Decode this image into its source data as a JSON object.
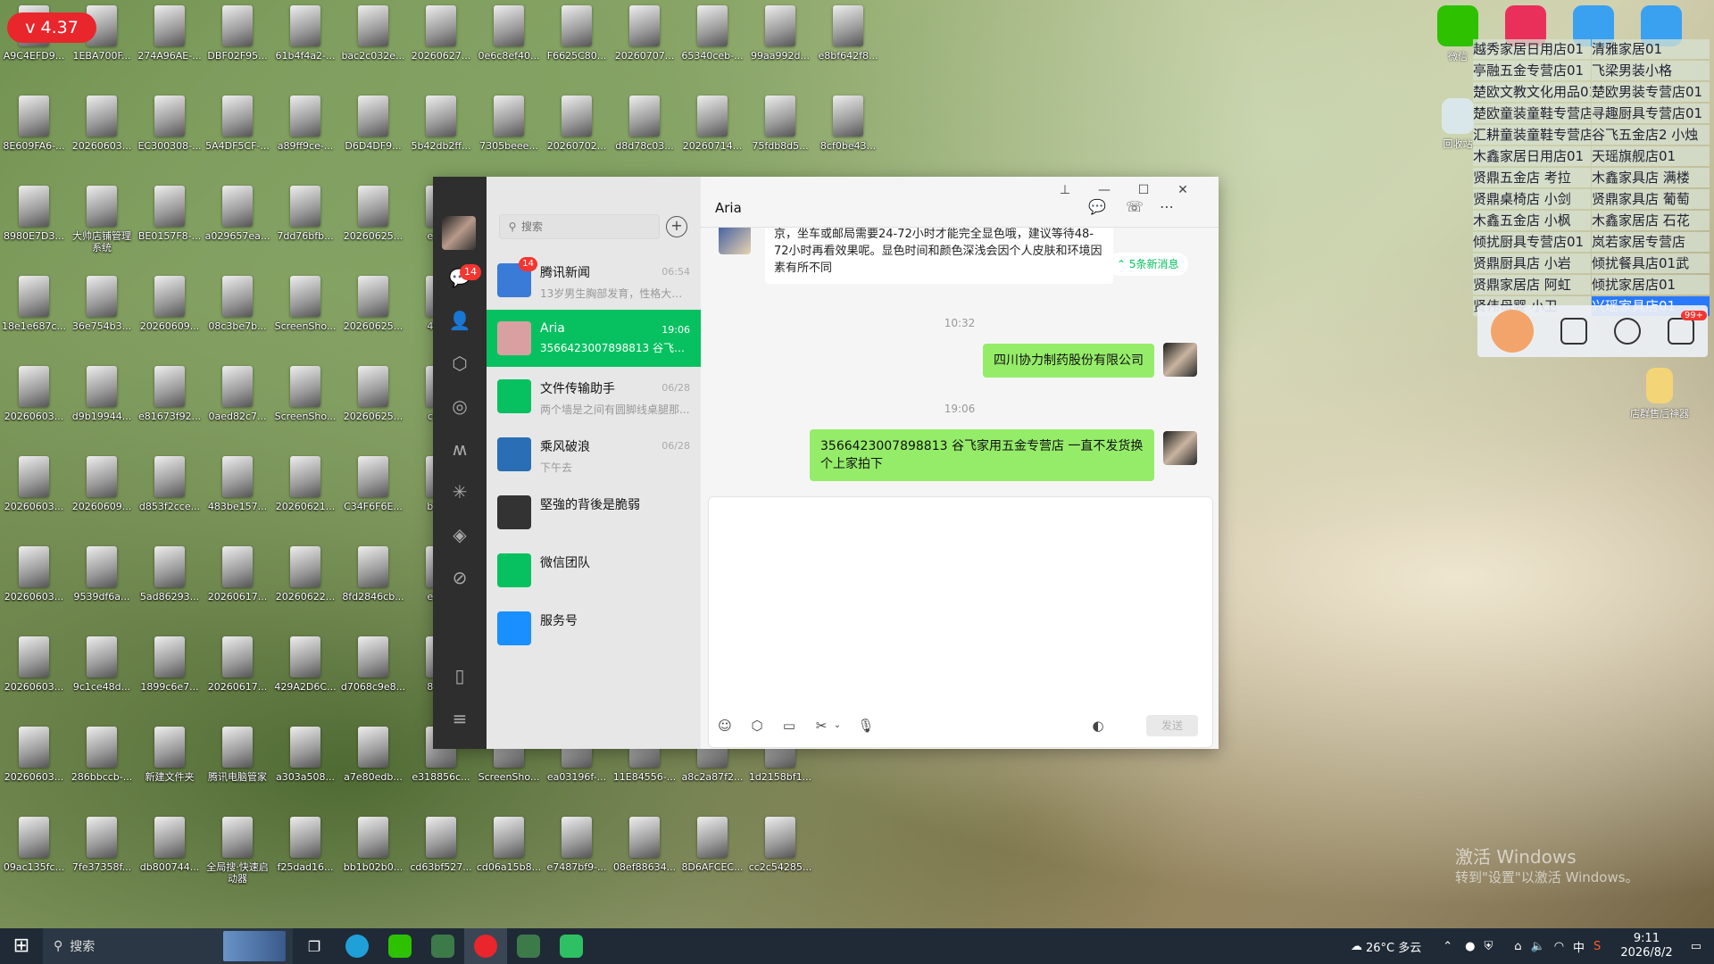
{
  "version_badge": "v 4.37",
  "desktop_labels": [
    "A9C4EFD9...",
    "1EBA700F...",
    "274A96AE-...",
    "DBF02F95...",
    "61b4f4a2-...",
    "bac2c032e...",
    "20260627...",
    "0e6c8ef40...",
    "F6625C80...",
    "20260707...",
    "65340ceb-...",
    "99aa992d...",
    "e8bf642f8...",
    "8E609FA6-...",
    "20260603...",
    "EC300308-...",
    "5A4DF5CF-...",
    "a89ff9ce-...",
    "D6D4DF9...",
    "5b42db2ff...",
    "7305beee...",
    "20260702...",
    "d8d78c03...",
    "20260714...",
    "75fdb8d5...",
    "8cf0be43...",
    "8980E7D3...",
    "大帅店铺管理系统",
    "BE0157F8-...",
    "a029657ea...",
    "7dd76bfb...",
    "20260625...",
    "e30...",
    "18e1e687c...",
    "36e754b3...",
    "20260609...",
    "08c3be7b...",
    "ScreenSho...",
    "20260625...",
    "4e8...",
    "20260603...",
    "d9b19944...",
    "e81673f92...",
    "0aed82c7...",
    "ScreenSho...",
    "20260625...",
    "ce3...",
    "20260603...",
    "20260609...",
    "d853f2cce...",
    "483be157...",
    "20260621...",
    "C34F6F6E...",
    "bd7...",
    "20260603...",
    "9539df6a...",
    "5ad86293...",
    "20260617...",
    "20260622...",
    "8fd2846cb...",
    "e79...",
    "20260603...",
    "9c1ce48d...",
    "1899c6e7...",
    "20260617...",
    "429A2D6C...",
    "d7068c9e8...",
    "857...",
    "20260603...",
    "286bbccb-...",
    "新建文件夹",
    "腾讯电脑管家",
    "a303a508...",
    "a7e80edb...",
    "e318856c...",
    "ScreenSho...",
    "ea03196f-...",
    "11E84556-...",
    "a8c2a87f2...",
    "1d2158bf1...",
    "09ac135fc...",
    "7fe37358f...",
    "db800744...",
    "全局搜·快速启动器",
    "f25dad16...",
    "bb1b02b0...",
    "cd63bf527...",
    "cd06a15b8...",
    "e7487bf9-...",
    "08ef88634...",
    "8D6AFCEC...",
    "cc2c54285..."
  ],
  "right_icons": {
    "wechat": "微信",
    "recycle": "回收站",
    "tool": "店群售后神器"
  },
  "right_panel_rows": [
    [
      "越秀家居日用店01",
      "清雅家居01"
    ],
    [
      "亭融五金专营店01",
      "飞梁男装小格"
    ],
    [
      "楚欧文教文化用品01",
      "楚欧男装专营店01"
    ],
    [
      "楚欧童装童鞋专营店",
      "寻趣厨具专营店01"
    ],
    [
      "汇耕童装童鞋专营店",
      "谷飞五金店2 小烛"
    ],
    [
      "木鑫家居日用店01",
      "天瑶旗舰店01"
    ],
    [
      "贤鼎五金店 考拉",
      "木鑫家具店 满楼"
    ],
    [
      "贤鼎桌椅店 小剑",
      "贤鼎家具店 葡萄"
    ],
    [
      "木鑫五金店 小枫",
      "木鑫家居店 石花"
    ],
    [
      "倾扰厨具专营店01",
      "岚若家居专营店"
    ],
    [
      "贤鼎厨具店 小岩",
      "倾扰餐具店01武"
    ],
    [
      "贤鼎家居店 阿虹",
      "倾扰家居店01"
    ],
    [
      "贤伟母婴 小卫",
      "兴瑶家具店01"
    ]
  ],
  "right_tool_badge": "99+",
  "wechat": {
    "nav_badge": "14",
    "search_placeholder": "搜索",
    "add_symbol": "+",
    "chats": [
      {
        "name": "腾讯新闻",
        "preview": "13岁男生胸部发育，性格大变...",
        "time": "06:54",
        "badge": "14"
      },
      {
        "name": "Aria",
        "preview": "3566423007898813 谷飞家...",
        "time": "19:06"
      },
      {
        "name": "文件传输助手",
        "preview": "两个墙是之间有圆脚线桌腿那...",
        "time": "06/28"
      },
      {
        "name": "乘风破浪",
        "preview": "下午去",
        "time": "06/28"
      },
      {
        "name": "堅強的背後是脆弱",
        "preview": "",
        "time": ""
      },
      {
        "name": "微信团队",
        "preview": "",
        "time": ""
      },
      {
        "name": "服务号",
        "preview": "",
        "time": ""
      }
    ],
    "title": "Aria",
    "window_controls": {
      "pin": "⊥",
      "min": "—",
      "max": "☐",
      "close": "✕"
    },
    "incoming_msg": "京，坐车或邮局需要24-72小时才能完全显色哦，建议等待48-72小时再看效果呢。显色时间和颜色深浅会因个人皮肤和环境因素有所不同",
    "new_msg_pill": "⌃ 5条新消息",
    "time1": "10:32",
    "out1": "四川协力制药股份有限公司",
    "time2": "19:06",
    "out2": "3566423007898813 谷飞家用五金专营店 一直不发货换个上家拍下",
    "send_label": "发送"
  },
  "taskbar": {
    "search_placeholder": "搜索",
    "weather": "26°C 多云",
    "ime": "中",
    "time": "9:11",
    "date": "2026/8/2"
  },
  "watermark": {
    "line1": "激活 Windows",
    "line2": "转到\"设置\"以激活 Windows。"
  },
  "colors": {
    "accent": "#07c160",
    "badge": "#f43530",
    "bubble_out": "#95ec69"
  }
}
